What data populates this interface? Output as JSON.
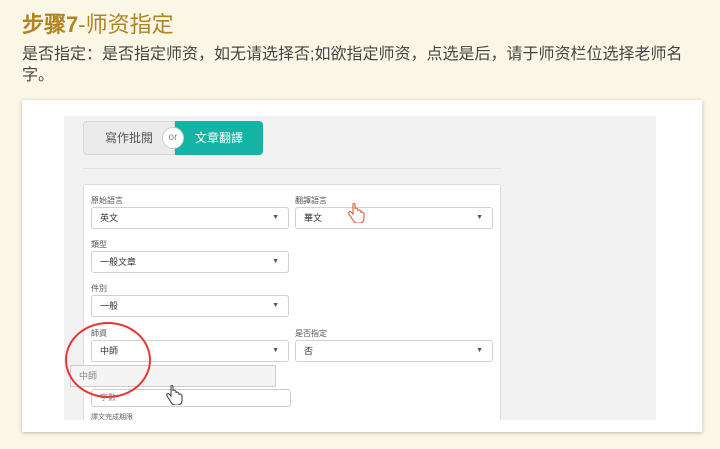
{
  "header": {
    "step_label": "步骤7",
    "step_topic": "-师资指定",
    "description": "是否指定：是否指定师资，如无请选择否;如欲指定师资，点选是后，请于师资栏位选择老师名字。"
  },
  "tabs": {
    "tab_a": "寫作批閱",
    "or": "or",
    "tab_b": "文章翻譯"
  },
  "form": {
    "source_lang": {
      "label": "原始語言",
      "value": "英文"
    },
    "target_lang": {
      "label": "翻譯語言",
      "value": "華文"
    },
    "type": {
      "label": "類型",
      "value": "一般文章"
    },
    "grade": {
      "label": "件別",
      "value": "一般"
    },
    "teacher": {
      "label": "師資",
      "value": "中師",
      "dropdown_option": "中師"
    },
    "assign": {
      "label": "是否指定",
      "value": "否"
    },
    "hidden_field_text": "字數",
    "truncated_label": "譯文完成期限"
  },
  "colors": {
    "accent_gold": "#b08423",
    "teal_tab": "#14b3a4",
    "highlight_red": "#e53935"
  },
  "icons": {
    "caret": "caret-down-icon",
    "cursor": "hand-pointer-icon"
  }
}
